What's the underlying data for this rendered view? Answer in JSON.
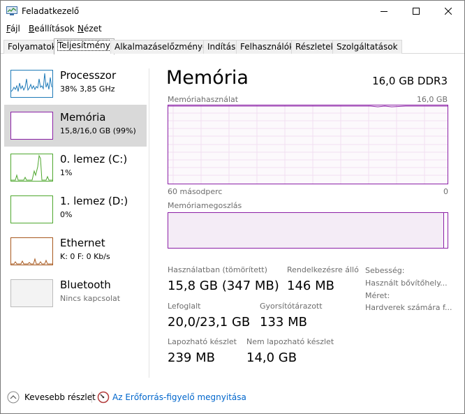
{
  "window": {
    "title": "Feladatkezelő",
    "minimize": "Minimize",
    "maximize": "Maximize",
    "close": "Close"
  },
  "menu": [
    {
      "label": "Fájl",
      "accel": "F",
      "rest": "ájl"
    },
    {
      "label": "Beállítások",
      "accel": "B",
      "rest": "eállítások"
    },
    {
      "label": "Nézet",
      "accel": "N",
      "rest": "ézet"
    }
  ],
  "tabs": [
    {
      "label": "Folyamatok",
      "active": false
    },
    {
      "label": "Teljesítmény",
      "active": true
    },
    {
      "label": "Alkalmazáselőzmények",
      "active": false
    },
    {
      "label": "Indítás",
      "active": false
    },
    {
      "label": "Felhasználók",
      "active": false
    },
    {
      "label": "Részletek",
      "active": false
    },
    {
      "label": "Szolgáltatások",
      "active": false
    }
  ],
  "sidebar": {
    "items": [
      {
        "title": "Processzor",
        "sub": "38%  3,85 GHz",
        "color": "#1e7ab8",
        "selected": false
      },
      {
        "title": "Memória",
        "sub": "15,8/16,0 GB (99%)",
        "color": "#8b1fa6",
        "selected": true
      },
      {
        "title": "0. lemez (C:)",
        "sub": "1%",
        "color": "#4ea72e",
        "selected": false
      },
      {
        "title": "1. lemez (D:)",
        "sub": "0%",
        "color": "#4ea72e",
        "selected": false
      },
      {
        "title": "Ethernet",
        "sub": "K: 0  F: 0 Kb/s",
        "color": "#a7581e",
        "selected": false
      },
      {
        "title": "Bluetooth",
        "sub": "Nincs kapcsolat",
        "color": "#999999",
        "selected": false
      }
    ]
  },
  "main": {
    "title": "Memória",
    "spec": "16,0 GB DDR3",
    "usage_label": "Memóriahasználat",
    "usage_max": "16,0 GB",
    "time_left": "60 másodperc",
    "time_right": "0",
    "composition_label": "Memóriamegoszlás",
    "stats": {
      "in_use_label": "Használatban (tömörített)",
      "in_use_value": "15,8 GB (347 MB)",
      "available_label": "Rendelkezésre álló",
      "available_value": "146 MB",
      "committed_label": "Lefoglalt",
      "committed_value": "20,0/23,1 GB",
      "cached_label": "Gyorsítótárazott",
      "cached_value": "133 MB",
      "paged_label": "Lapozható készlet",
      "paged_value": "239 MB",
      "nonpaged_label": "Nem lapozható készlet",
      "nonpaged_value": "14,0 GB"
    },
    "side_stats": {
      "speed": "Sebesség:",
      "slots": "Használt bővítőhely...",
      "form": "Méret:",
      "reserved": "Hardverek számára f..."
    }
  },
  "footer": {
    "fewer_details": "Kevesebb részlet",
    "resource_monitor": "Az Erőforrás-figyelő megnyitása"
  },
  "colors": {
    "memory": "#8b1fa6",
    "link": "#0066cc"
  }
}
